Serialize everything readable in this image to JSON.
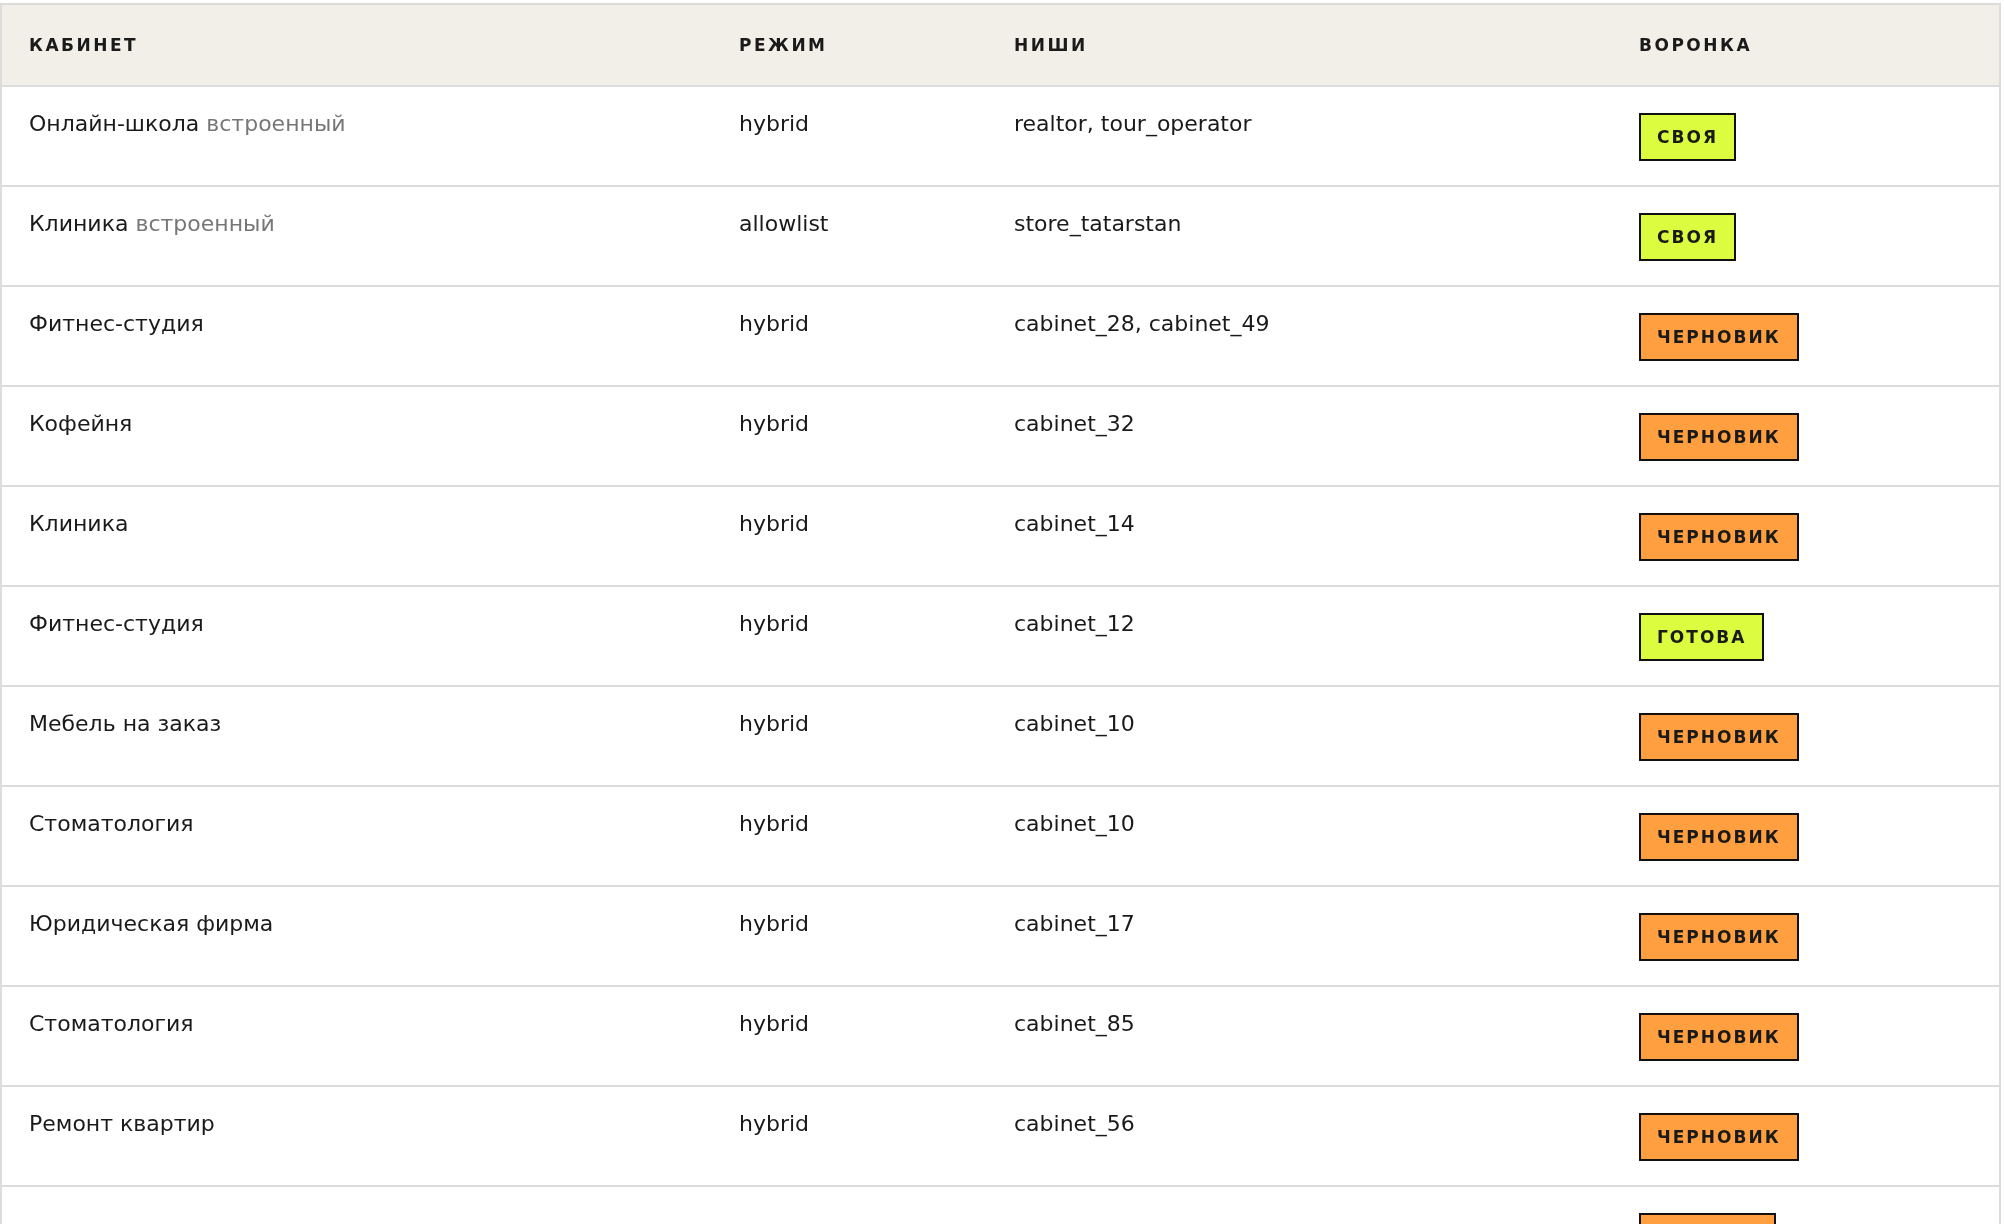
{
  "table": {
    "columns": [
      "КАБИНЕТ",
      "РЕЖИМ",
      "НИШИ",
      "ВОРОНКА"
    ],
    "rows": [
      {
        "cabinet": "Онлайн-школа",
        "tag": "встроенный",
        "mode": "hybrid",
        "niches": "realtor, tour_operator",
        "funnel": {
          "label": "СВОЯ",
          "kind": "own"
        }
      },
      {
        "cabinet": "Клиника",
        "tag": "встроенный",
        "mode": "allowlist",
        "niches": "store_tatarstan",
        "funnel": {
          "label": "СВОЯ",
          "kind": "own"
        }
      },
      {
        "cabinet": "Фитнес-студия",
        "mode": "hybrid",
        "niches": "cabinet_28, cabinet_49",
        "funnel": {
          "label": "ЧЕРНОВИК",
          "kind": "draft"
        }
      },
      {
        "cabinet": "Кофейня",
        "mode": "hybrid",
        "niches": "cabinet_32",
        "funnel": {
          "label": "ЧЕРНОВИК",
          "kind": "draft"
        }
      },
      {
        "cabinet": "Клиника",
        "mode": "hybrid",
        "niches": "cabinet_14",
        "funnel": {
          "label": "ЧЕРНОВИК",
          "kind": "draft"
        }
      },
      {
        "cabinet": "Фитнес-студия",
        "mode": "hybrid",
        "niches": "cabinet_12",
        "funnel": {
          "label": "ГОТОВА",
          "kind": "ready"
        }
      },
      {
        "cabinet": "Мебель на заказ",
        "mode": "hybrid",
        "niches": "cabinet_10",
        "funnel": {
          "label": "ЧЕРНОВИК",
          "kind": "draft"
        }
      },
      {
        "cabinet": "Стоматология",
        "mode": "hybrid",
        "niches": "cabinet_10",
        "funnel": {
          "label": "ЧЕРНОВИК",
          "kind": "draft"
        }
      },
      {
        "cabinet": "Юридическая фирма",
        "mode": "hybrid",
        "niches": "cabinet_17",
        "funnel": {
          "label": "ЧЕРНОВИК",
          "kind": "draft"
        }
      },
      {
        "cabinet": "Стоматология",
        "mode": "hybrid",
        "niches": "cabinet_85",
        "funnel": {
          "label": "ЧЕРНОВИК",
          "kind": "draft"
        }
      },
      {
        "cabinet": "Ремонт квартир",
        "mode": "hybrid",
        "niches": "cabinet_56",
        "funnel": {
          "label": "ЧЕРНОВИК",
          "kind": "draft"
        }
      },
      {
        "funnel": {
          "kind": "draft"
        }
      }
    ]
  }
}
